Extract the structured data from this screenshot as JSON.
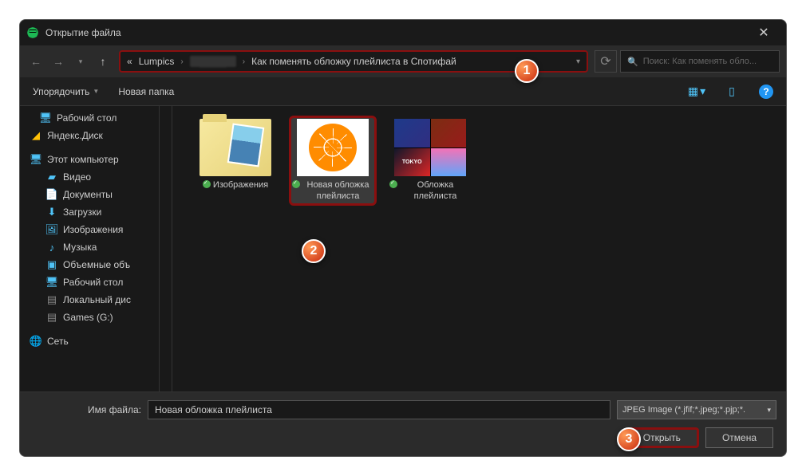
{
  "titlebar": {
    "title": "Открытие файла"
  },
  "breadcrumb": {
    "root": "«",
    "p1": "Lumpics",
    "p2_obscured": "████",
    "p3": "Как поменять обложку плейлиста в Спотифай"
  },
  "search": {
    "placeholder": "Поиск: Как поменять обло..."
  },
  "toolbar": {
    "organize": "Упорядочить",
    "newfolder": "Новая папка"
  },
  "sidebar": {
    "desktop1": "Рабочий стол",
    "yadisk": "Яндекс.Диск",
    "thispc": "Этот компьютер",
    "video": "Видео",
    "docs": "Документы",
    "downloads": "Загрузки",
    "pictures": "Изображения",
    "music": "Музыка",
    "volumes": "Объемные объ",
    "desktop2": "Рабочий стол",
    "localdisk": "Локальный дис",
    "games": "Games (G:)",
    "network": "Сеть"
  },
  "files": {
    "f1": "Изображения",
    "f2": "Новая обложка плейлиста",
    "f3": "Обложка плейлиста",
    "cover_text": "TOKYO"
  },
  "footer": {
    "label": "Имя файла:",
    "filename": "Новая обложка плейлиста",
    "filetype": "JPEG Image (*.jfif;*.jpeg;*.pjp;*.",
    "open": "Открыть",
    "cancel": "Отмена"
  },
  "callouts": {
    "c1": "1",
    "c2": "2",
    "c3": "3"
  }
}
